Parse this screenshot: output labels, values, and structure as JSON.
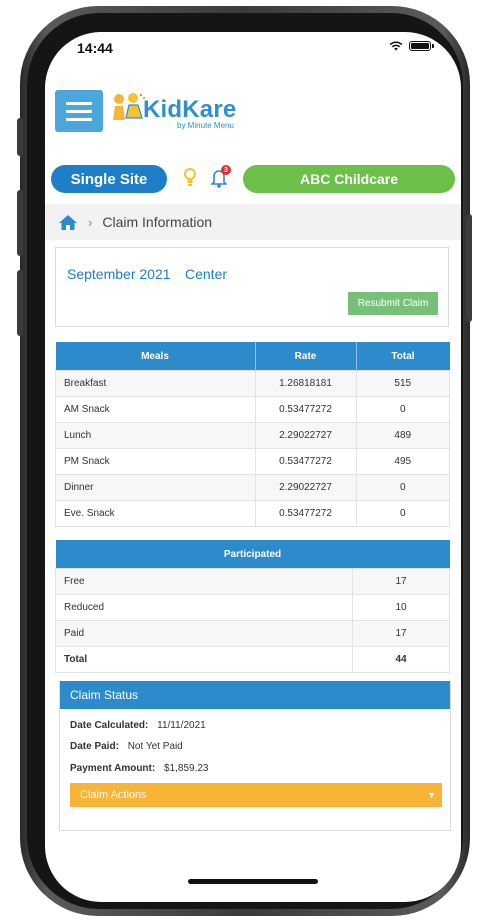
{
  "status_bar": {
    "time": "14:44"
  },
  "header": {
    "logo_word": "KidKare",
    "logo_tag": "by Minute Menu",
    "site_button": "Single Site",
    "notification_count": "3",
    "center_button": "ABC Childcare"
  },
  "breadcrumb": {
    "current": "Claim Information"
  },
  "claim": {
    "period": "September 2021",
    "type": "Center",
    "resubmit_label": "Resubmit Claim"
  },
  "meals_table": {
    "headers": [
      "Meals",
      "Rate",
      "Total"
    ],
    "rows": [
      [
        "Breakfast",
        "1.26818181",
        "515"
      ],
      [
        "AM Snack",
        "0.53477272",
        "0"
      ],
      [
        "Lunch",
        "2.29022727",
        "489"
      ],
      [
        "PM Snack",
        "0.53477272",
        "495"
      ],
      [
        "Dinner",
        "2.29022727",
        "0"
      ],
      [
        "Eve. Snack",
        "0.53477272",
        "0"
      ]
    ]
  },
  "participated_table": {
    "header": "Participated",
    "rows": [
      [
        "Free",
        "17"
      ],
      [
        "Reduced",
        "10"
      ],
      [
        "Paid",
        "17"
      ],
      [
        "Total",
        "44"
      ]
    ]
  },
  "claim_status": {
    "title": "Claim Status",
    "date_calculated_label": "Date Calculated:",
    "date_calculated_value": "11/11/2021",
    "date_paid_label": "Date Paid:",
    "date_paid_value": "Not Yet Paid",
    "payment_amount_label": "Payment Amount:",
    "payment_amount_value": "$1,859.23",
    "actions_label": "Claim Actions"
  },
  "colors": {
    "primary_blue": "#2e8bcb",
    "green": "#6cc04a",
    "orange": "#f7b437"
  }
}
